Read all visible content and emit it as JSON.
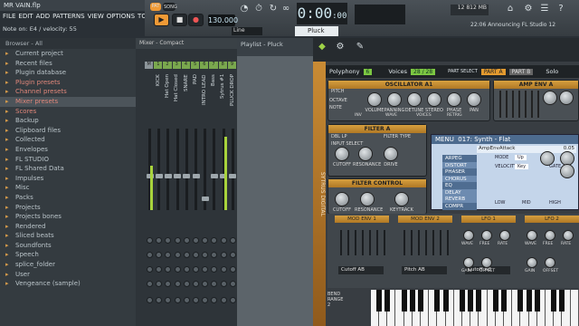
{
  "window": {
    "title": "MR VAIN.flp"
  },
  "menu": [
    "FILE",
    "EDIT",
    "ADD",
    "PATTERNS",
    "VIEW",
    "OPTIONS",
    "TOOLS",
    "?"
  ],
  "hint": "Note on: E4 / velocity: 55",
  "transport": {
    "pat": "PAT",
    "song": "SONG",
    "tempo": "130.000",
    "time": "0:00",
    "time_sub": ":00",
    "cpu_value": "12",
    "ram_value": "812 MB",
    "cpu_sub": "12",
    "line_mode": "Line",
    "pattern_name": "Pluck",
    "news": "22:06 Announcing FL Studio 12"
  },
  "browser": {
    "header": "Browser - All",
    "items": [
      {
        "label": "Current project",
        "icon": "folder"
      },
      {
        "label": "Recent files",
        "icon": "folder"
      },
      {
        "label": "Plugin database",
        "icon": "folder"
      },
      {
        "label": "Plugin presets",
        "icon": "folder",
        "preset": true
      },
      {
        "label": "Channel presets",
        "icon": "folder",
        "preset": true
      },
      {
        "label": "Mixer presets",
        "icon": "folder",
        "preset": true,
        "selected": true
      },
      {
        "label": "Scores",
        "icon": "folder",
        "preset": true
      },
      {
        "label": "Backup",
        "icon": "folder"
      },
      {
        "label": "Clipboard files",
        "icon": "folder"
      },
      {
        "label": "Collected",
        "icon": "folder"
      },
      {
        "label": "Envelopes",
        "icon": "folder"
      },
      {
        "label": "FL STUDIO",
        "icon": "folder"
      },
      {
        "label": "FL Shared Data",
        "icon": "folder"
      },
      {
        "label": "Impulses",
        "icon": "folder"
      },
      {
        "label": "Misc",
        "icon": "folder"
      },
      {
        "label": "Packs",
        "icon": "folder"
      },
      {
        "label": "Projects",
        "icon": "folder"
      },
      {
        "label": "Projects bones",
        "icon": "folder"
      },
      {
        "label": "Rendered",
        "icon": "folder"
      },
      {
        "label": "Sliced beats",
        "icon": "folder"
      },
      {
        "label": "Soundfonts",
        "icon": "folder"
      },
      {
        "label": "Speech",
        "icon": "folder"
      },
      {
        "label": "splice_folder",
        "icon": "folder"
      },
      {
        "label": "User",
        "icon": "folder"
      },
      {
        "label": "Vengeance (sample)",
        "icon": "folder"
      }
    ]
  },
  "mixer": {
    "header": "Mixer - Compact",
    "channel_numbers": [
      "M",
      "1",
      "2",
      "3",
      "4",
      "5",
      "6",
      "7",
      "8",
      "9"
    ],
    "channel_names": [
      "KICK",
      "Hat Open",
      "Hat Closed",
      "SNARE",
      "PAD",
      "INTRO LEAD",
      "Bass",
      "Sytrus #1",
      "PLUCK DROP"
    ],
    "meter_levels": [
      0.55,
      0,
      0,
      0,
      0,
      0,
      0,
      0,
      0.9,
      0
    ]
  },
  "playlist": {
    "title": "Playlist - Pluck"
  },
  "plugin": {
    "name": "Sytrus",
    "side_label": "SYTRUS DIGITAL",
    "polyphony_label": "Polyphony",
    "polyphony_value": "6",
    "voices_label": "Voices",
    "voices_value": "28 / 28",
    "part_select": "PART SELECT",
    "part_a": "PART A",
    "part_b": "PART B",
    "solo": "Solo",
    "oscillator": {
      "title": "OSCILLATOR A1",
      "labels": [
        "PITCH",
        "OCTAVE",
        "NOTE",
        "VOLUME",
        "PANNING",
        "DETUNE",
        "STEREO",
        "PHASE",
        "PAN"
      ],
      "buttons": [
        "INV",
        "WAVE",
        "VOICES",
        "RETRIG"
      ],
      "voices_val": "4"
    },
    "amp": {
      "title": "AMP ENV A"
    },
    "filter": {
      "title": "FILTER A",
      "mode": "DBL LP",
      "input_select": "INPUT SELECT",
      "type_label": "FILTER TYPE",
      "knobs": [
        "CUTOFF",
        "RESONANCE",
        "DRIVE"
      ]
    },
    "filter_control": {
      "title": "FILTER CONTROL",
      "knobs": [
        "CUTOFF",
        "RESONANCE",
        "KEYTRACK"
      ]
    },
    "arp": {
      "menu": "MENU",
      "title": "017: Synth - Flat",
      "param": "AmpEnvAttack",
      "param_value": "0.05",
      "items": [
        "ARPEG",
        "DISTORT",
        "PHASER",
        "CHORUS",
        "EQ",
        "DELAY",
        "REVERB",
        "COMPR"
      ],
      "active": [
        "DISTORT",
        "CHORUS",
        "DELAY",
        "REVERB"
      ],
      "knob_labels": [
        "MODE",
        "VELOCITY",
        "GATE"
      ],
      "mode_val": "Up",
      "velocity_val": "Key",
      "bands": [
        "LOW",
        "MID",
        "HIGH"
      ]
    },
    "modenv": {
      "titles": [
        "MOD ENV 1",
        "MOD ENV 2",
        "LFO 1",
        "LFO 2"
      ],
      "dest": [
        "Cutoff AB",
        "Pitch AB",
        "Cutoff AB"
      ],
      "lfo_labels": [
        "WAVE",
        "FREE",
        "RATE",
        "GAIN",
        "OFFSET"
      ]
    },
    "bend": "BEND RANGE 2"
  },
  "colors": {
    "accent": "#f09a36",
    "meter": "#a8d33c",
    "sytrus_gold": "#d6a03f"
  }
}
